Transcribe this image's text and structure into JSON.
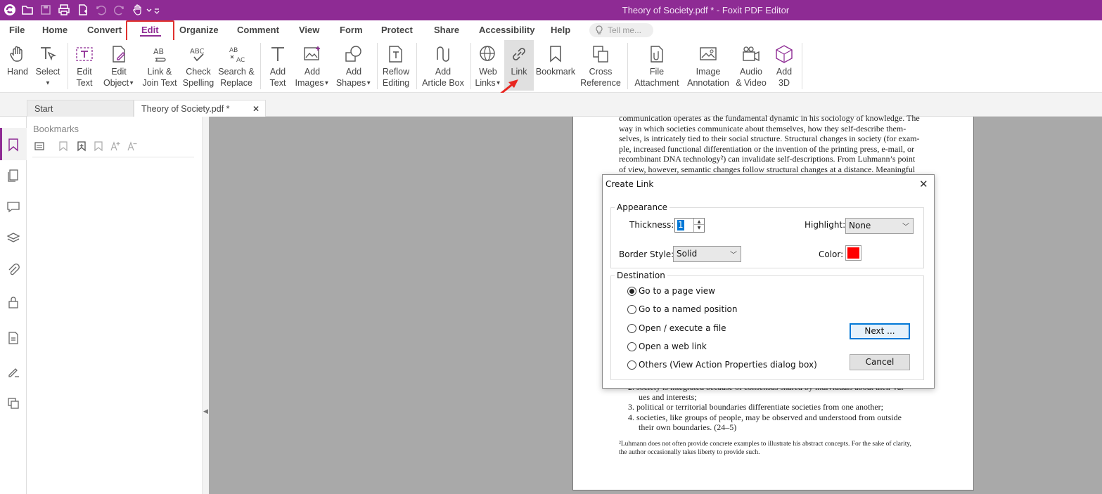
{
  "window": {
    "title": "Theory of Society.pdf * - Foxit PDF Editor"
  },
  "quick_access": [
    "app-logo-icon",
    "open-folder-icon",
    "save-icon",
    "print-icon",
    "new-file-icon",
    "undo-icon",
    "redo-icon",
    "hand-tool-icon",
    "customize-icon"
  ],
  "menu": {
    "file": "File",
    "home": "Home",
    "convert": "Convert",
    "edit": "Edit",
    "organize": "Organize",
    "comment": "Comment",
    "view": "View",
    "form": "Form",
    "protect": "Protect",
    "share": "Share",
    "accessibility": "Accessibility",
    "help": "Help",
    "tell_me": "Tell me..."
  },
  "ribbon": {
    "hand": "Hand",
    "select": "Select",
    "edit_text_1": "Edit",
    "edit_text_2": "Text",
    "edit_object_1": "Edit",
    "edit_object_2": "Object",
    "link_join_1": "Link &",
    "link_join_2": "Join Text",
    "check_spelling_1": "Check",
    "check_spelling_2": "Spelling",
    "search_replace_1": "Search &",
    "search_replace_2": "Replace",
    "add_text_1": "Add",
    "add_text_2": "Text",
    "add_images_1": "Add",
    "add_images_2": "Images",
    "add_shapes_1": "Add",
    "add_shapes_2": "Shapes",
    "reflow_1": "Reflow",
    "reflow_2": "Editing",
    "article_1": "Add",
    "article_2": "Article Box",
    "web_links_1": "Web",
    "web_links_2": "Links",
    "link": "Link",
    "bookmark": "Bookmark",
    "cross_ref_1": "Cross",
    "cross_ref_2": "Reference",
    "file_attach_1": "File",
    "file_attach_2": "Attachment",
    "image_annot_1": "Image",
    "image_annot_2": "Annotation",
    "audio_video_1": "Audio",
    "audio_video_2": "& Video",
    "add3d_1": "Add",
    "add3d_2": "3D"
  },
  "tabs": {
    "start": "Start",
    "document": "Theory of Society.pdf *"
  },
  "bookmarks_panel": {
    "title": "Bookmarks"
  },
  "page_text": {
    "paragraph_lines": [
      "communication operates as the fundamental dynamic in his sociology of knowledge. The",
      "way in which societies communicate about themselves, how they self-describe them-",
      "selves, is intricately tied to their social structure. Structural changes in society (for exam-",
      "ple, increased functional differentiation or the invention of the printing press, e-mail, or",
      "recombinant DNA technology²) can invalidate self-descriptions. From Luhmann’s point",
      "of view, however, semantic changes follow structural changes at a distance. Meaningful"
    ],
    "list_2a": "2.  society is integrated because of consensus shared by individuals about their val-",
    "list_2b": "ues and interests;",
    "list_3": "3.  political or territorial boundaries differentiate societies from one another;",
    "list_4a": "4.  societies, like groups of people, may be observed and understood from outside",
    "list_4b": "their own boundaries. (24–5)",
    "footnote_1": "²Luhmann does not often provide concrete examples to illustrate his abstract concepts. For the sake of clarity,",
    "footnote_2": "the author occasionally takes liberty to provide such."
  },
  "dialog": {
    "title": "Create Link",
    "appearance_label": "Appearance",
    "thickness_label": "Thickness:",
    "thickness_value": "1",
    "highlight_label": "Highlight:",
    "highlight_value": "None",
    "border_style_label": "Border Style:",
    "border_style_value": "Solid",
    "color_label": "Color:",
    "color_value": "#ff0000",
    "destination_label": "Destination",
    "options": [
      {
        "label": "Go to a page view",
        "selected": true
      },
      {
        "label": "Go to a named position",
        "selected": false
      },
      {
        "label": "Open / execute a file",
        "selected": false
      },
      {
        "label": "Open a web link",
        "selected": false
      },
      {
        "label": "Others (View Action Properties dialog box)",
        "selected": false
      }
    ],
    "next_button": "Next ...",
    "cancel_button": "Cancel"
  },
  "colors": {
    "brand": "#8e2b94",
    "highlight_box": "#e0312e",
    "arrow": "#e8251f",
    "link_color": "#ff0000"
  }
}
